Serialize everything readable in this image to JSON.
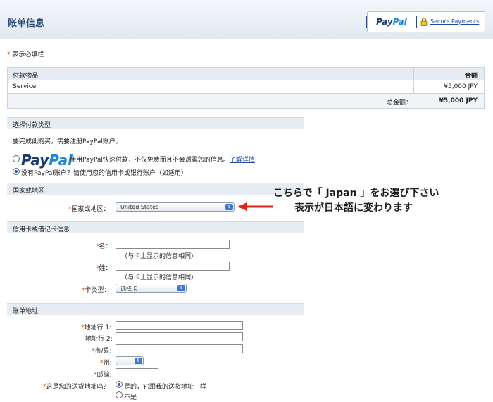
{
  "header": {
    "title": "账单信息",
    "paypal_logo_a": "Pay",
    "paypal_logo_b": "Pal",
    "secure_label": "Secure Payments"
  },
  "required_note": "表示必填栏",
  "summary": {
    "col_item": "付款物品",
    "col_amount": "金额",
    "rows": [
      {
        "item": "Service",
        "amount": "¥5,000 JPY"
      }
    ],
    "total_label": "总金额：",
    "total_value": "¥5,000 JPY"
  },
  "payment_type": {
    "section": "选择付款类型",
    "prompt": "要完成此购买，需要注册PayPal账户。",
    "logo_a": "Pay",
    "logo_b": "Pal",
    "option_paypal": "使用PayPal快速付款，不仅免费而且不会透露您的信息。",
    "learn_more": "了解详情",
    "option_card": "没有PayPal账户？请使用您的信用卡或银行账户（如适用）"
  },
  "country": {
    "section": "国家或地区",
    "label": "国家或地区：",
    "value": "United States"
  },
  "callout": {
    "line1": "こちらで「 Japan 」をお選び下さい",
    "line2": "表示が日本語に変わります"
  },
  "card": {
    "section": "信用卡或借记卡信息",
    "first_name_label": "名：",
    "name_hint": "（与卡上显示的信息相同）",
    "last_name_label": "姓：",
    "last_name_hint": "（与卡上显示的信息相同）",
    "card_type_label": "卡类型：",
    "card_type_value": "选择卡"
  },
  "billing": {
    "section": "账单地址",
    "address1_label": "地址行 1:",
    "address2_label": "地址行 2:",
    "city_label": "市/县:",
    "state_label": "州:",
    "zip_label": "邮编:",
    "shipping_question": "这是您的送货地址吗？",
    "yes_option": "是的，它跟我的送货地址一样",
    "no_option": "不是"
  },
  "colors": {
    "accent": "#2b4d7e",
    "link": "#1f4ea0",
    "required": "#e05a00",
    "arrow": "#d9261c"
  }
}
